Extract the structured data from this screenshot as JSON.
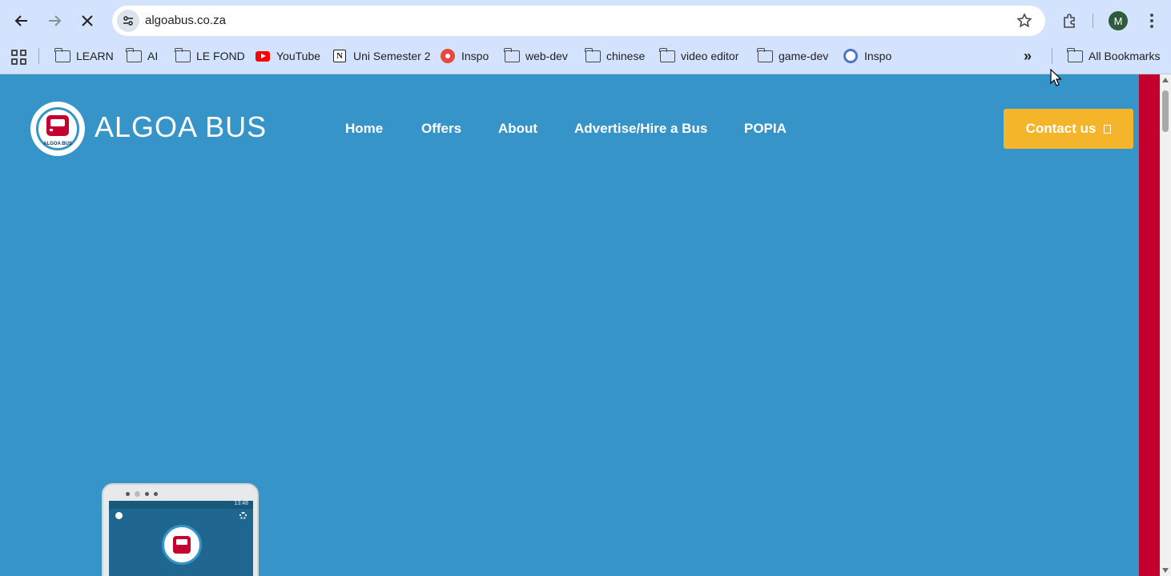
{
  "browser": {
    "url": "algoabus.co.za",
    "profile_initial": "M",
    "bookmarks": [
      {
        "label": "LEARN",
        "icon": "folder-icon"
      },
      {
        "label": "AI",
        "icon": "folder-icon"
      },
      {
        "label": "LE FOND",
        "icon": "folder-icon"
      },
      {
        "label": "YouTube",
        "icon": "youtube-icon"
      },
      {
        "label": "Uni Semester 2",
        "icon": "notion-icon"
      },
      {
        "label": "Inspo",
        "icon": "red-circle-icon"
      },
      {
        "label": "web-dev",
        "icon": "folder-icon"
      },
      {
        "label": "chinese",
        "icon": "folder-icon"
      },
      {
        "label": "video editor",
        "icon": "folder-icon"
      },
      {
        "label": "game-dev",
        "icon": "folder-icon"
      },
      {
        "label": "Inspo",
        "icon": "globe-icon"
      }
    ],
    "all_bookmarks": "All Bookmarks"
  },
  "site": {
    "brand": "ALGOA BUS",
    "logo_caption": "ALGOA BUS",
    "nav": [
      "Home",
      "Offers",
      "About",
      "Advertise/Hire a Bus",
      "POPIA"
    ],
    "contact_label": "Contact us",
    "phone_time": "13:48"
  },
  "colors": {
    "page_bg": "#3794c8",
    "accent": "#f4b52b",
    "brand_red": "#c4002f",
    "chrome_bg": "#d3e3fd"
  }
}
